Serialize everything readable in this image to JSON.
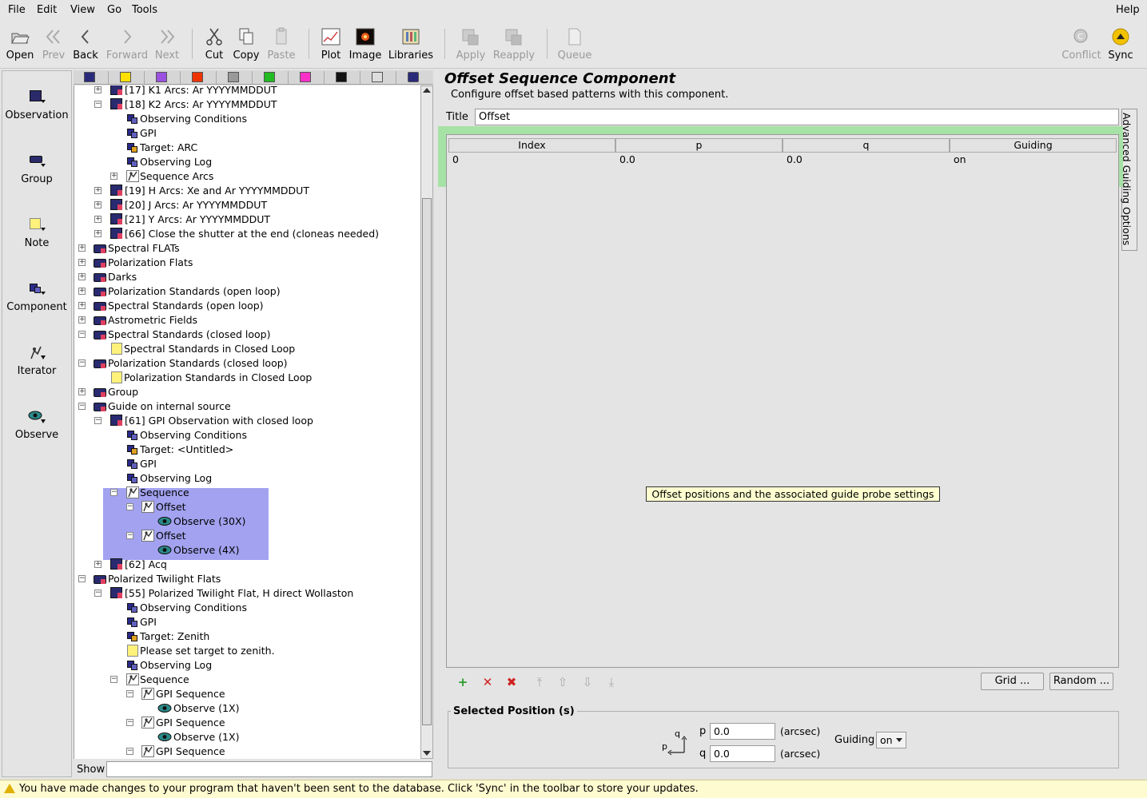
{
  "menubar": {
    "file": "File",
    "edit": "Edit",
    "view": "View",
    "go": "Go",
    "tools": "Tools",
    "help": "Help"
  },
  "toolbar": {
    "open": "Open",
    "prev": "Prev",
    "back": "Back",
    "forward": "Forward",
    "next": "Next",
    "cut": "Cut",
    "copy": "Copy",
    "paste": "Paste",
    "plot": "Plot",
    "image": "Image",
    "libraries": "Libraries",
    "apply": "Apply",
    "reapply": "Reapply",
    "queue": "Queue",
    "conflict": "Conflict",
    "sync": "Sync"
  },
  "palette": {
    "observation": "Observation",
    "group": "Group",
    "note": "Note",
    "component": "Component",
    "iterator": "Iterator",
    "observe": "Observe"
  },
  "tree": {
    "rows": [
      {
        "label": "[17] K1 Arcs: Ar YYYYMMDDUT"
      },
      {
        "label": "[18] K2 Arcs: Ar YYYYMMDDUT"
      },
      {
        "label": "Observing Conditions"
      },
      {
        "label": "GPI"
      },
      {
        "label": "Target: ARC"
      },
      {
        "label": "Observing Log"
      },
      {
        "label": "Sequence Arcs"
      },
      {
        "label": "[19] H Arcs: Xe and Ar YYYYMMDDUT"
      },
      {
        "label": "[20] J Arcs: Ar YYYYMMDDUT"
      },
      {
        "label": "[21] Y Arcs: Ar YYYYMMDDUT"
      },
      {
        "label": "[66] Close the shutter at the end (cloneas needed)"
      },
      {
        "label": "Spectral FLATs"
      },
      {
        "label": "Polarization Flats"
      },
      {
        "label": "Darks"
      },
      {
        "label": "Polarization Standards (open loop)"
      },
      {
        "label": "Spectral Standards (open loop)"
      },
      {
        "label": "Astrometric Fields"
      },
      {
        "label": "Spectral Standards (closed loop)"
      },
      {
        "label": "Spectral Standards in Closed Loop"
      },
      {
        "label": "Polarization Standards (closed loop)"
      },
      {
        "label": "Polarization Standards in Closed Loop"
      },
      {
        "label": "Group"
      },
      {
        "label": "Guide on internal source"
      },
      {
        "label": "[61] GPI Observation with closed loop"
      },
      {
        "label": "Observing Conditions"
      },
      {
        "label": "Target: <Untitled>"
      },
      {
        "label": "GPI"
      },
      {
        "label": "Observing Log"
      },
      {
        "label": "Sequence"
      },
      {
        "label": "Offset"
      },
      {
        "label": "Observe (30X)"
      },
      {
        "label": "Offset"
      },
      {
        "label": "Observe (4X)"
      },
      {
        "label": "[62] Acq"
      },
      {
        "label": "Polarized Twilight Flats"
      },
      {
        "label": "[55] Polarized Twilight Flat, H direct Wollaston"
      },
      {
        "label": "Observing Conditions"
      },
      {
        "label": "GPI"
      },
      {
        "label": "Target: Zenith"
      },
      {
        "label": "Please set target to zenith."
      },
      {
        "label": "Observing Log"
      },
      {
        "label": "Sequence"
      },
      {
        "label": "GPI Sequence"
      },
      {
        "label": "Observe (1X)"
      },
      {
        "label": "GPI Sequence"
      },
      {
        "label": "Observe (1X)"
      },
      {
        "label": "GPI Sequence"
      }
    ],
    "show_label": "Show",
    "show_value": ""
  },
  "component": {
    "heading": "Offset Sequence Component",
    "description": "Configure offset based patterns with this component.",
    "title_label": "Title",
    "title_value": "Offset",
    "advanced_tab": "Advanced Guiding Options",
    "table": {
      "headers": [
        "Index",
        "p",
        "q",
        "Guiding"
      ],
      "rows": [
        [
          "0",
          "0.0",
          "0.0",
          "on"
        ]
      ]
    },
    "tooltip": "Offset positions and the associated guide probe settings",
    "grid_button": "Grid ...",
    "random_button": "Random ...",
    "selected_position": {
      "title": "Selected Position (s)",
      "p_label": "p",
      "p_value": "0.0",
      "p_unit": "(arcsec)",
      "q_label": "q",
      "q_value": "0.0",
      "q_unit": "(arcsec)",
      "guiding_label": "Guiding",
      "guiding_value": "on",
      "axis_q": "q",
      "axis_p": "p"
    }
  },
  "status": {
    "message": "You have made changes to your program that haven't been sent to the database.  Click 'Sync' in the toolbar to store your updates."
  },
  "colors": {
    "selection": "#a2a2f0",
    "table_row": "#a6e2a6",
    "tooltip": "#ffffd0",
    "status_bg": "#fffbd0",
    "sync_icon": "#f2c200"
  }
}
